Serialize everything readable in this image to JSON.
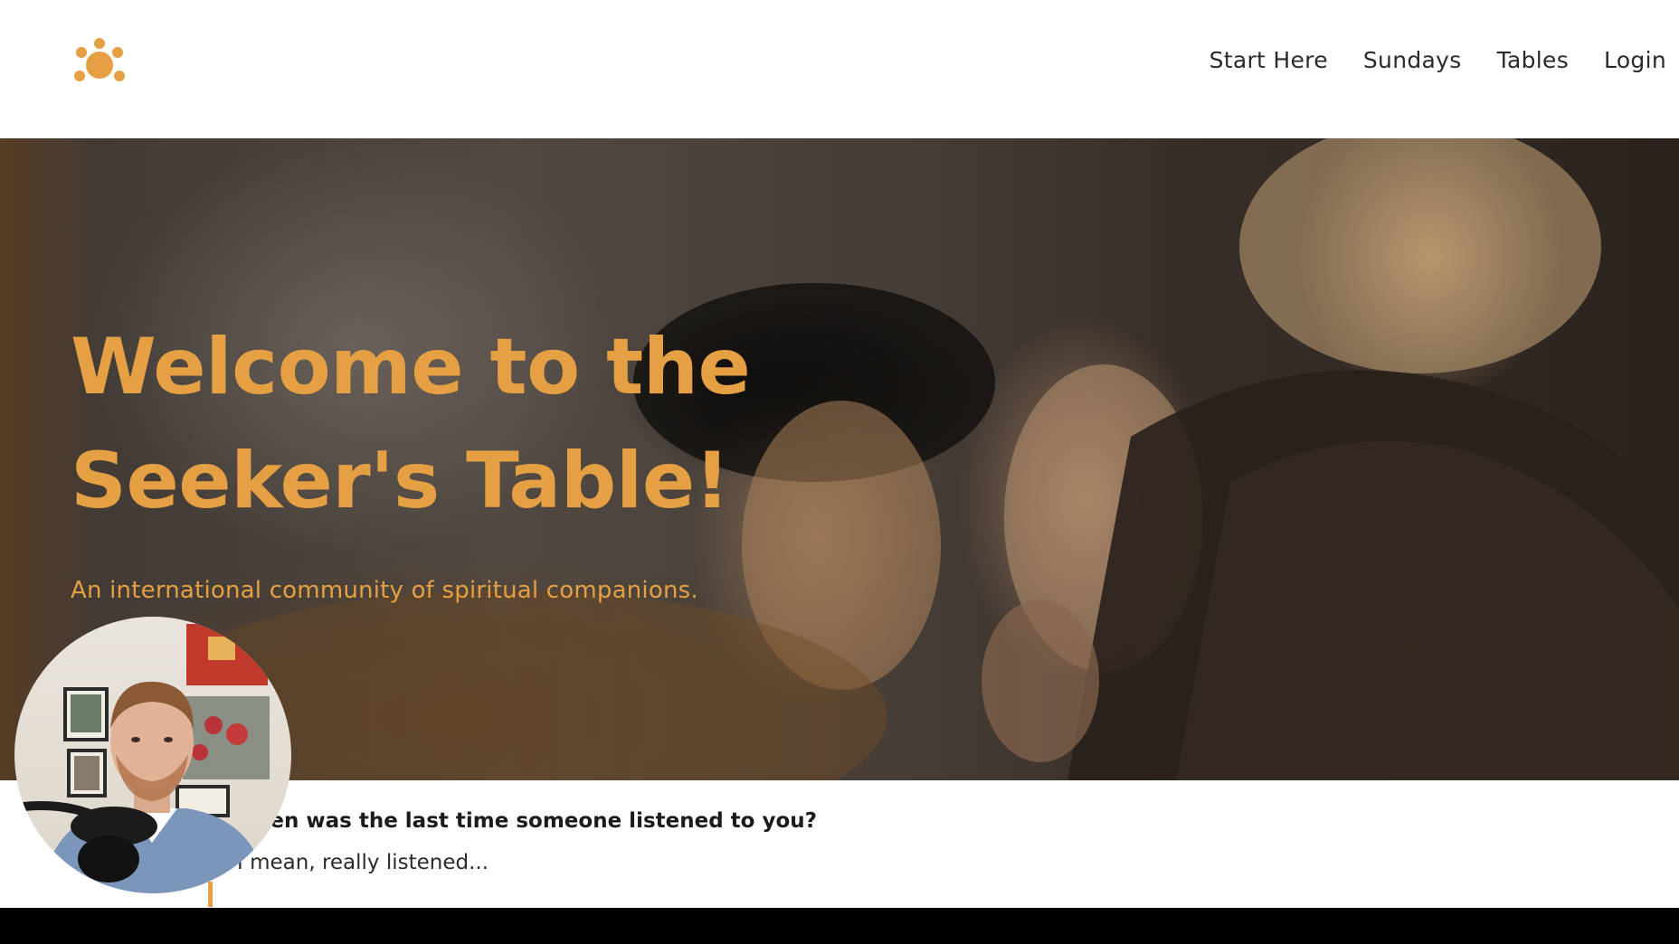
{
  "header": {
    "logo_icon": "sun-dots-icon",
    "brand_color": "#e5a043",
    "nav": [
      {
        "label": "Start Here"
      },
      {
        "label": "Sundays"
      },
      {
        "label": "Tables"
      },
      {
        "label": "Login"
      }
    ]
  },
  "hero": {
    "title_line1": "Welcome to the",
    "title_line2": "Seeker's Table!",
    "subtitle": "An international community of spiritual companions."
  },
  "intro": {
    "question": "hen was the last time someone listened to you?",
    "answer": "I mean, really listened..."
  },
  "overlay": {
    "webcam_icon": "presenter-video-icon"
  }
}
